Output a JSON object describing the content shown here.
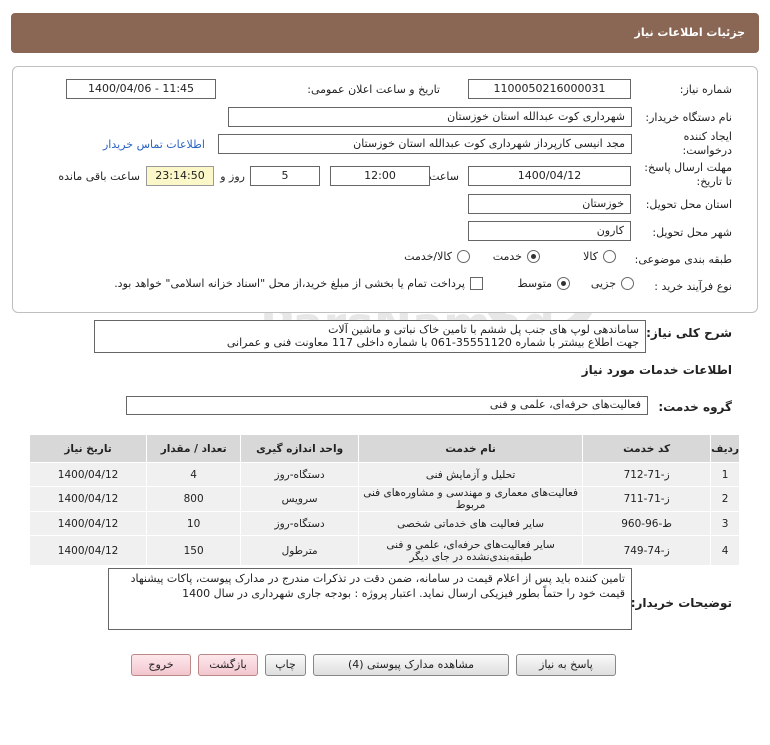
{
  "header": {
    "title": "جزئیات اطلاعات نیاز"
  },
  "fields": {
    "need_number_label": "شماره نیاز:",
    "need_number": "1100050216000031",
    "announce_label": "تاریخ و ساعت اعلان عمومی:",
    "announce_value": "1400/04/06 - 11:45",
    "buyer_org_label": "نام دستگاه خریدار:",
    "buyer_org": "شهرداری کوت عبدالله استان خوزستان",
    "creator_label": "ایجاد کننده درخواست:",
    "creator": "مجد انیسی کارپرداز شهرداری کوت عبدالله استان خوزستان",
    "contact_link": "اطلاعات تماس خریدار",
    "deadline_label": "مهلت ارسال پاسخ: تا تاریخ:",
    "deadline_date": "1400/04/12",
    "time_label": "ساعت",
    "deadline_time": "12:00",
    "days_value": "5",
    "days_label": "روز و",
    "remaining_time": "23:14:50",
    "remaining_label": "ساعت باقی مانده",
    "province_label": "استان محل تحویل:",
    "province": "خوزستان",
    "city_label": "شهر محل تحویل:",
    "city": "کارون",
    "category_label": "طبقه بندی موضوعی:",
    "category_options": [
      "کالا",
      "خدمت",
      "کالا/خدمت"
    ],
    "process_label": "نوع فرآیند خرید :",
    "process_options": [
      "جزیی",
      "متوسط"
    ],
    "payment_note": "پرداخت تمام یا بخشی از مبلغ خرید،از محل \"اسناد خزانه اسلامی\" خواهد بود."
  },
  "summary": {
    "label": "شرح کلی نیاز:",
    "line1": "ساماندهی لوپ های جنب پل ششم با تامین خاک نباتی و ماشین آلات",
    "line2": "جهت اطلاع بیشتر با شماره 35551120-061 با شماره داخلی 117 معاونت فنی و عمرانی"
  },
  "services": {
    "section_title": "اطلاعات خدمات مورد نیاز",
    "group_label": "گروه خدمت:",
    "group_value": "فعالیت‌های حرفه‌ای، علمی و فنی",
    "columns": [
      "ردیف",
      "کد خدمت",
      "نام خدمت",
      "واحد اندازه گیری",
      "تعداد / مقدار",
      "تاریخ نیاز"
    ],
    "rows": [
      [
        "1",
        "ز-71-712",
        "تحلیل و آزمایش فنی",
        "دستگاه-روز",
        "4",
        "1400/04/12"
      ],
      [
        "2",
        "ز-71-711",
        "فعالیت‌های معماری و مهندسی و مشاوره‌های فنی مربوط",
        "سرویس",
        "800",
        "1400/04/12"
      ],
      [
        "3",
        "ط-96-960",
        "سایر فعالیت های خدماتی شخصی",
        "دستگاه-روز",
        "10",
        "1400/04/12"
      ],
      [
        "4",
        "ز-74-749",
        "سایر فعالیت‌های حرفه‌ای، علمی و فنی طبقه‌بندی‌نشده در جای دیگر",
        "مترطول",
        "150",
        "1400/04/12"
      ]
    ]
  },
  "buyer_notes": {
    "label": "توضیحات خریدار:",
    "text": "تامین کننده باید پس از اعلام قیمت در سامانه، ضمن دقت در تذکرات مندرج در مدارک پیوست، پاکات پیشنهاد قیمت خود را حتماً بطور فیزیکی ارسال نماید. اعتبار پروژه : بودجه جاری شهرداری در سال 1400"
  },
  "buttons": {
    "reply": "پاسخ به نیاز",
    "attachments": "مشاهده مدارک پیوستی (4)",
    "print": "چاپ",
    "back": "بازگشت",
    "exit": "خروج"
  },
  "colors": {
    "header": "#8a6654",
    "timer_bg": "#fcf7c8",
    "link": "#2a63c2"
  }
}
